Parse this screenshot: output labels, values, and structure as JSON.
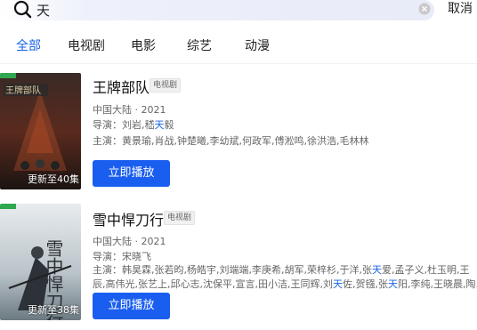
{
  "search": {
    "query": "天",
    "cancel_label": "取消"
  },
  "tabs": [
    {
      "label": "全部",
      "active": true
    },
    {
      "label": "电视剧",
      "active": false
    },
    {
      "label": "电影",
      "active": false
    },
    {
      "label": "综艺",
      "active": false
    },
    {
      "label": "动漫",
      "active": false
    }
  ],
  "results": [
    {
      "title": "王牌部队",
      "type_tag": "电视剧",
      "region_year": "中国大陆 · 2021",
      "director_prefix": "导演：",
      "director_plain": "刘岩,嵇",
      "director_hl": "天",
      "director_rest": "毅",
      "cast_prefix": "主演：",
      "cast_plain": "黄景瑜,肖战,钟楚曦,李幼斌,何政军,傅淞鸣,徐洪浩,毛林林",
      "play_label": "立即播放",
      "poster_caption": "更新至40集",
      "poster_title_art": "王牌部队"
    },
    {
      "title": "雪中悍刀行",
      "type_tag": "电视剧",
      "region_year": "中国大陆 · 2021",
      "director_prefix": "导演：",
      "director_plain": "宋晓飞",
      "cast_prefix": "主演：",
      "cast_line1_a": "韩昊霖,张若昀,杨皓宇,刘端端,李庚希,胡军,荣梓杉,于洋,张",
      "cast_line1_hl": "天",
      "cast_line1_b": "爱,孟子义,杜玉明,王",
      "cast_line2_a": "辰,高伟光,张艺上,邱心志,沈保平,宣言,田小洁,王同辉,刘",
      "cast_line2_hl1": "天",
      "cast_line2_b": "佐,贺镪,张",
      "cast_line2_hl2": "天",
      "cast_line2_c": "阳,李纯,王晓晨,陶...",
      "play_label": "立即播放",
      "poster_caption": "更新至38集",
      "poster_title_art": "雪中悍刀行"
    }
  ],
  "colors": {
    "accent": "#1a63e8",
    "button": "#1a5ef0"
  }
}
